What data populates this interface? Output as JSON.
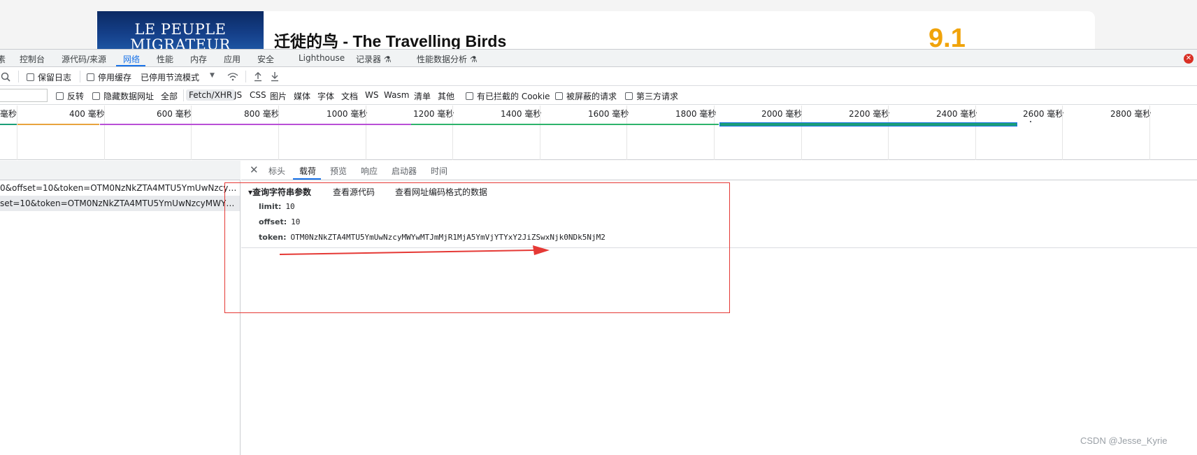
{
  "page": {
    "movie_title": "迁徙的鸟 - The Travelling Birds",
    "movie_score": "9.1",
    "poster_top_text": "",
    "poster_line1": "LE PEUPLE",
    "poster_line2": "MIGRATEUR"
  },
  "devtools": {
    "tabs": [
      "素",
      "控制台",
      "源代码/来源",
      "网络",
      "性能",
      "内存",
      "应用",
      "安全",
      "Lighthouse",
      "记录器 ⚗",
      "性能数据分析 ⚗"
    ],
    "active_tab": "网络",
    "close_icon": "✕"
  },
  "toolbar1": {
    "preserve_log": "保留日志",
    "disable_cache": "停用缓存",
    "throttling": "已停用节流模式",
    "throttling_caret": "▼"
  },
  "filters": {
    "invert": "反转",
    "hide_data_urls": "隐藏数据网址",
    "all": "全部",
    "types": [
      "Fetch/XHR",
      "JS",
      "CSS",
      "图片",
      "媒体",
      "字体",
      "文档",
      "WS",
      "Wasm",
      "清单",
      "其他"
    ],
    "selected_type": "Fetch/XHR",
    "blocked_cookies": "有已拦截的 Cookie",
    "blocked_requests": "被屏蔽的请求",
    "third_party": "第三方请求"
  },
  "timeline": {
    "ticks": [
      "毫秒",
      "400 毫秒",
      "600 毫秒",
      "800 毫秒",
      "1000 毫秒",
      "1200 毫秒",
      "1400 毫秒",
      "1600 毫秒",
      "1800 毫秒",
      "2000 毫秒",
      "2200 毫秒",
      "2400 毫秒",
      "2600 毫秒",
      "2800 毫秒"
    ],
    "colors": {
      "orange": "#e8a33d",
      "purple": "#b94fd6",
      "green": "#2db36b",
      "blue": "#1a73e8",
      "teal": "#1b9e77"
    }
  },
  "requests": [
    "0&offset=10&token=OTM0NzNkZTA4MTU5YmUwNzcyMWY...",
    "set=10&token=OTM0NzNkZTA4MTU5YmUwNzcyMWYwMTJm..."
  ],
  "detail": {
    "tabs": [
      "标头",
      "载荷",
      "预览",
      "响应",
      "启动器",
      "时间"
    ],
    "active_tab": "载荷",
    "section_title": "▾查询字符串参数",
    "view_source": "查看源代码",
    "view_url_encoded": "查看网址编码格式的数据",
    "params": [
      {
        "key": "limit:",
        "value": "10"
      },
      {
        "key": "offset:",
        "value": "10"
      },
      {
        "key": "token:",
        "value": "OTM0NzNkZTA4MTU5YmUwNzcyMWYwMTJmMjR1MjA5YmVjYTYxY2JiZSwxNjk0NDk5NjM2"
      }
    ]
  },
  "watermark": "CSDN @Jesse_Kyrie"
}
